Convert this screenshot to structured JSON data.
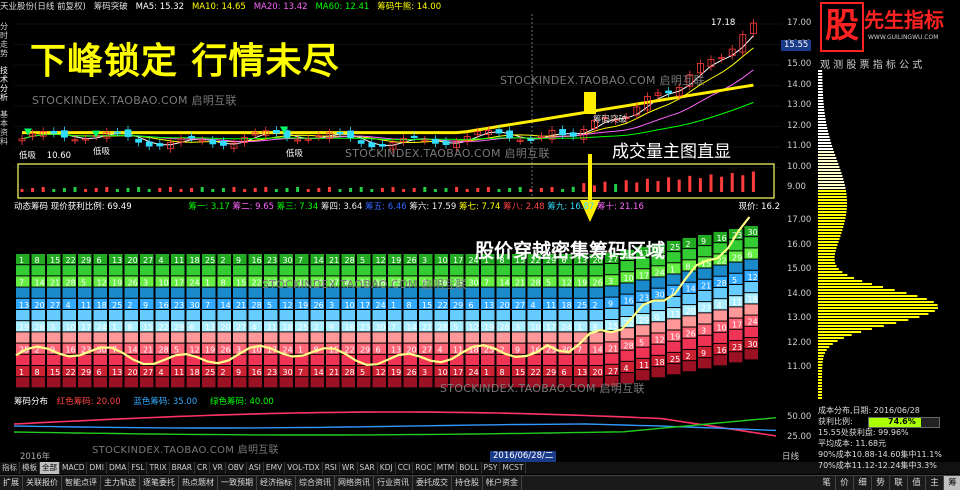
{
  "header": {
    "stock": "天业股份(日线 前复权)",
    "indicator": "筹码突破",
    "ma5": "MA5: 15.32",
    "ma10": "MA10: 14.65",
    "ma20": "MA20: 13.42",
    "ma60": "MA60: 12.41",
    "bull": "筹码牛熊: 14.00"
  },
  "left_tabs": [
    "分时走势",
    "技术分析",
    "基本资料"
  ],
  "headline": "下峰锁定 行情未尽",
  "annotation_volume": "成交量主图直显",
  "annotation_cross": "股价穿越密集筹码区域",
  "watermark": "STOCKINDEX.TAOBAO.COM 启明互联",
  "main_labels": {
    "low1": "低吸",
    "low1_price": "10.60",
    "low2": "低吸",
    "low3": "低吸",
    "high": "17.18",
    "current_tag": "15.55",
    "mid_label": "筹码突破"
  },
  "price_axis_main": [
    "17.00",
    "16.00",
    "15.00",
    "14.00",
    "13.00",
    "12.00",
    "11.00",
    "10.00",
    "9.00"
  ],
  "price_axis_chips": [
    "17.00",
    "16.00",
    "15.00",
    "14.00",
    "13.00",
    "12.00",
    "11.00"
  ],
  "price_axis_dist": [
    "50.00",
    "25.00"
  ],
  "chip_header": {
    "title": "动态筹码",
    "ratio": "现价获利比例: 69.49",
    "c1": "筹一: 3.17",
    "c2": "筹二: 9.65",
    "c3": "筹三: 7.34",
    "c4": "筹四: 3.64",
    "c5": "筹五: 6.46",
    "c6": "筹六: 17.59",
    "c7": "筹七: 7.74",
    "c8": "筹八: 2.48",
    "c9": "筹九: 16.87",
    "c10": "筹十: 21.16",
    "cur": "现价: 16.2"
  },
  "dist_header": {
    "title": "筹码分布",
    "red": "红色筹码: 20.00",
    "blue": "蓝色筹码: 35.00",
    "green": "绿色筹码: 40.00"
  },
  "dates": {
    "left": "2016年",
    "cursor": "2016/06/28/二",
    "period": "日线"
  },
  "bottom_tabs": [
    "指标",
    "模板",
    "全部",
    "MACD",
    "DMI",
    "DMA",
    "FSL",
    "TRIX",
    "BRAR",
    "CR",
    "VR",
    "OBV",
    "ASI",
    "EMV",
    "VOL-TDX",
    "RSI",
    "WR",
    "SAR",
    "KDJ",
    "CCI",
    "ROC",
    "MTM",
    "BOLL",
    "PSY",
    "MCST"
  ],
  "bottom_menu": [
    "扩展",
    "关联报价",
    "智能点评",
    "主力轨迹",
    "逐笔委托",
    "热点题材",
    "一致预期",
    "经济指标",
    "综合资讯",
    "网络资讯",
    "行业资讯",
    "委托成交",
    "持仓股",
    "帐户资金"
  ],
  "right_panel": {
    "logo_char": "股",
    "logo_text": "先生指标",
    "logo_url": "WWW.GUILINGWU.COM",
    "title": "观 测 股 票 指 标 公 式",
    "info": {
      "date": "成本分布,日期: 2016/06/28",
      "profit_label": "获利比例:",
      "profit_value": "74.6%",
      "profit_line": "15.55处获利盘: 99.96%",
      "avg": "平均成本: 11.68元",
      "c90": "90%成本10.88-14.60集中11.1%",
      "c70": "70%成本11.12-12.24集中3.3%"
    },
    "tabs": [
      "笔",
      "价",
      "细",
      "势",
      "联",
      "值",
      "主",
      "筹"
    ]
  },
  "colors": {
    "yellow": "#ffff00",
    "red": "#ff3c3c",
    "green": "#00d000",
    "cyan": "#33ddff"
  }
}
